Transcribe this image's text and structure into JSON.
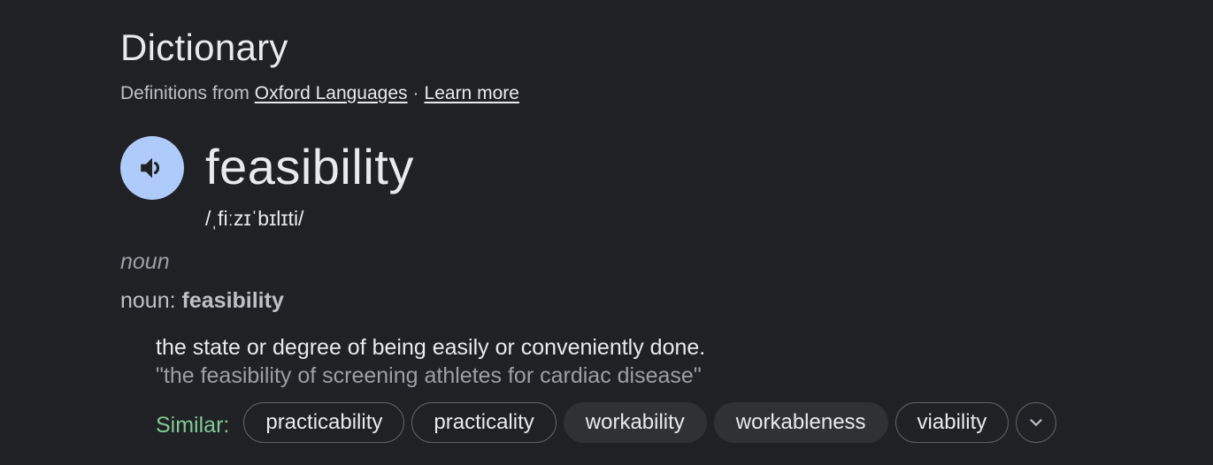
{
  "header": {
    "title": "Dictionary",
    "source_prefix": "Definitions from",
    "source_link": "Oxford Languages",
    "separator": "·",
    "learn_more": "Learn more"
  },
  "entry": {
    "word": "feasibility",
    "phonetic": "/ˌfiːzɪˈbɪlɪti/",
    "speaker_icon": "volume-up-icon",
    "part_of_speech": "noun",
    "pos_label": "noun",
    "pos_colon": ": ",
    "pos_word": "feasibility",
    "definition": "the state or degree of being easily or conveniently done.",
    "example": "\"the feasibility of screening athletes for cardiac disease\""
  },
  "similar": {
    "label": "Similar:",
    "chips": [
      {
        "label": "practicability",
        "style": "outlined"
      },
      {
        "label": "practicality",
        "style": "outlined"
      },
      {
        "label": "workability",
        "style": "filled"
      },
      {
        "label": "workableness",
        "style": "filled"
      },
      {
        "label": "viability",
        "style": "outlined"
      }
    ],
    "expand_icon": "chevron-down-icon"
  },
  "colors": {
    "background": "#202124",
    "speaker_bg": "#aecbfa",
    "similar_label": "#81c995",
    "text_primary": "#e8eaed",
    "text_secondary": "#9aa0a6"
  }
}
